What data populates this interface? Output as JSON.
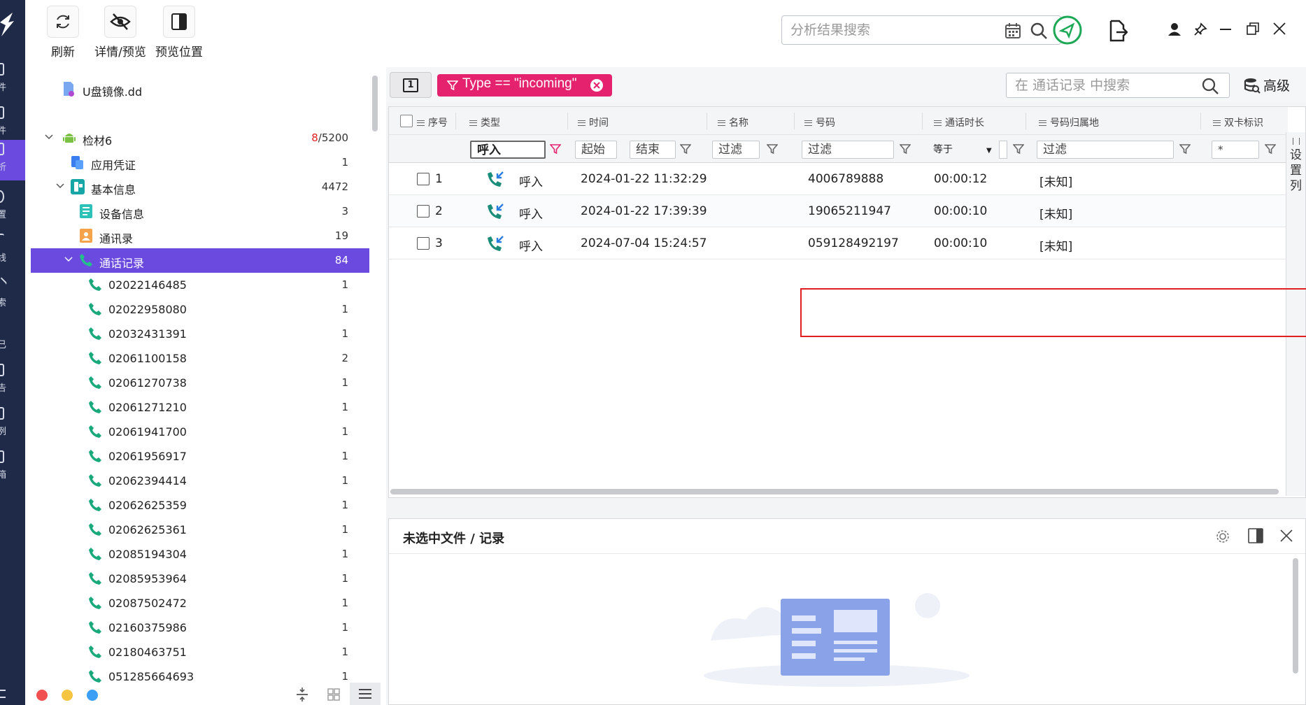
{
  "toolbar": {
    "refresh_label": "刷新",
    "detail_preview_label": "详情/预览",
    "preview_position_label": "预览位置"
  },
  "top_search": {
    "placeholder": "分析结果搜索"
  },
  "left_rail": {
    "items": [
      {
        "label": "件"
      },
      {
        "label": "件"
      },
      {
        "label": "析"
      },
      {
        "label": "置"
      },
      {
        "label": "线"
      },
      {
        "label": "索"
      },
      {
        "label": "已"
      },
      {
        "label": "告"
      },
      {
        "label": "例"
      },
      {
        "label": "箱"
      }
    ]
  },
  "tree": {
    "image_file": "U盘镜像.dd",
    "device": {
      "label": "检材6",
      "count_highlight": "8",
      "count_total": "/5200"
    },
    "app_credentials": {
      "label": "应用凭证",
      "count": "1"
    },
    "basic_info": {
      "label": "基本信息",
      "count": "4472"
    },
    "device_info": {
      "label": "设备信息",
      "count": "3"
    },
    "contacts": {
      "label": "通讯录",
      "count": "19"
    },
    "call_records": {
      "label": "通话记录",
      "count": "84"
    },
    "numbers": [
      {
        "label": "02022146485",
        "count": "1"
      },
      {
        "label": "02022958080",
        "count": "1"
      },
      {
        "label": "02032431391",
        "count": "1"
      },
      {
        "label": "02061100158",
        "count": "2"
      },
      {
        "label": "02061270738",
        "count": "1"
      },
      {
        "label": "02061271210",
        "count": "1"
      },
      {
        "label": "02061941700",
        "count": "1"
      },
      {
        "label": "02061956917",
        "count": "1"
      },
      {
        "label": "02062394414",
        "count": "1"
      },
      {
        "label": "02062625359",
        "count": "1"
      },
      {
        "label": "02062625361",
        "count": "1"
      },
      {
        "label": "02085194304",
        "count": "1"
      },
      {
        "label": "02085953964",
        "count": "1"
      },
      {
        "label": "02087502472",
        "count": "1"
      },
      {
        "label": "02160375986",
        "count": "1"
      },
      {
        "label": "02180463751",
        "count": "1"
      },
      {
        "label": "051285664693",
        "count": "1"
      }
    ]
  },
  "filter_bar": {
    "page_num": "1",
    "chip_text": "Type == \"incoming\"",
    "search_placeholder": "在 通话记录 中搜索",
    "advanced_label": "高级"
  },
  "table": {
    "headers": [
      "序号",
      "类型",
      "时间",
      "名称",
      "号码",
      "通话时长",
      "号码归属地",
      "双卡标识"
    ],
    "filters": {
      "type": "呼入",
      "time_start": "起始",
      "time_end": "结束",
      "name": "过滤",
      "number": "过滤",
      "duration_op": "等于",
      "location": "过滤",
      "dual_sim": "*"
    },
    "rows": [
      {
        "idx": "1",
        "type": "呼入",
        "time": "2024-01-22 11:32:29",
        "number": "4006789888",
        "duration": "00:00:12",
        "location": "[未知]"
      },
      {
        "idx": "2",
        "type": "呼入",
        "time": "2024-01-22 17:39:39",
        "number": "19065211947",
        "duration": "00:00:10",
        "location": "[未知]"
      },
      {
        "idx": "3",
        "type": "呼入",
        "time": "2024-07-04 15:24:57",
        "number": "059128492197",
        "duration": "00:00:10",
        "location": "[未知]"
      }
    ],
    "settings_col_label": "设置列"
  },
  "detail": {
    "title": "未选中文件 / 记录"
  },
  "colors": {
    "accent": "#6b4ae0",
    "chip": "#e5226e",
    "rail": "#1f2a48",
    "phone_green": "#1aa97a",
    "highlight_red": "#e02020"
  }
}
